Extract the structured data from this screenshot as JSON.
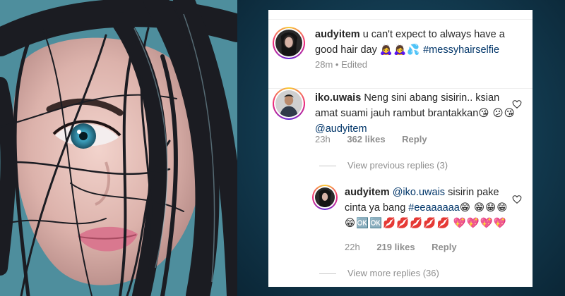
{
  "post": {
    "username": "audyitem",
    "caption": "u can't expect to always have a good hair day",
    "caption_emoji": "🙇‍♀️🙇‍♀️💦",
    "hashtag": "#messyhairselfie",
    "time": "28m",
    "edited": "• Edited"
  },
  "comments": [
    {
      "username": "iko.uwais",
      "text": "Neng sini abang sisirin.. ksian amat suami jauh rambut brantakkan",
      "emoji_inline": "😘",
      "emoji_line2": "😕😘",
      "mention": "@audyitem",
      "time": "23h",
      "likes": "362 likes",
      "reply": "Reply"
    }
  ],
  "replies_toggle_previous": "View previous replies (3)",
  "reply": {
    "username": "audyitem",
    "mention": "@iko.uwais",
    "text": "sisirin pake cinta ya bang",
    "hashtag": "#eeaaaaaa",
    "emoji_inline": "😁",
    "emoji_line1": "😁😁😁😁",
    "emoji_line1_flag": "🆗🆗",
    "emoji_line1_kiss": "💋💋💋💋💋",
    "emoji_line2": "💖💖💖💖",
    "time": "22h",
    "likes": "219 likes",
    "reply_label": "Reply"
  },
  "replies_toggle_more": "View more replies (36)",
  "colors": {
    "background": "#123a4f",
    "card": "#ffffff",
    "text": "#262626",
    "muted": "#8e8e8e",
    "link": "#003569"
  },
  "icons": [
    "heart-icon",
    "avatar-ring"
  ]
}
